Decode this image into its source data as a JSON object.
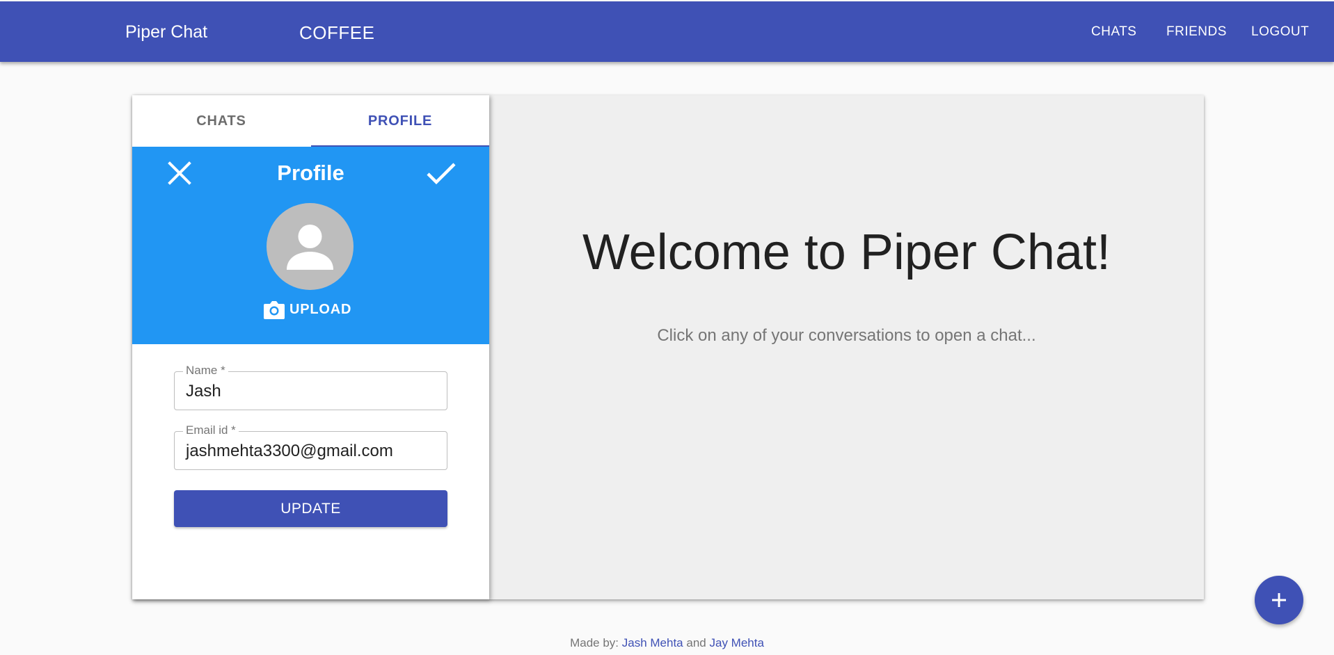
{
  "appbar": {
    "brand": "Piper Chat",
    "context": "COFFEE",
    "nav": {
      "chats": "CHATS",
      "friends": "FRIENDS",
      "logout": "LOGOUT"
    },
    "color": "#3f51b5"
  },
  "sidebar": {
    "tabs": {
      "chats": "CHATS",
      "profile": "PROFILE"
    },
    "active_tab": "PROFILE",
    "profile": {
      "title": "Profile",
      "upload_label": "UPLOAD",
      "header_color": "#2196f3",
      "name_label": "Name *",
      "name_value": "Jash",
      "email_label": "Email id *",
      "email_value": "jashmehta3300@gmail.com",
      "update_label": "UPDATE",
      "icons": {
        "close": "close-icon",
        "confirm": "check-icon",
        "avatar": "person-icon",
        "camera": "camera-icon"
      }
    }
  },
  "main": {
    "welcome": "Welcome to Piper Chat!",
    "subtitle": "Click on any of your conversations to open a chat..."
  },
  "fab": {
    "icon": "plus-icon"
  },
  "footer": {
    "prefix": "Made by:",
    "author1": "Jash Mehta",
    "joiner": "and",
    "author2": "Jay Mehta"
  }
}
